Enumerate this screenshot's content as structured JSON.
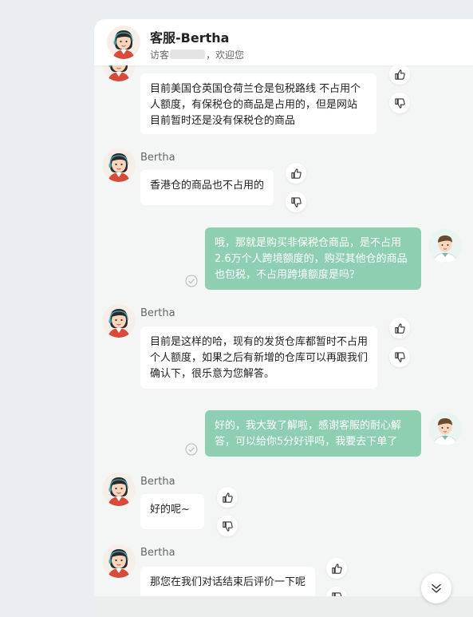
{
  "header": {
    "title": "客服-Bertha",
    "subtitle_prefix": "访客",
    "subtitle_suffix": "，欢迎您"
  },
  "messages": [
    {
      "sender": "Bertha",
      "role": "agent",
      "text": "目前美国仓英国仓荷兰仓是包税路线 不占用个人额度，有保税仓的商品是占用的，但是网站目前暂时还是没有保税仓的商品"
    },
    {
      "sender": "Bertha",
      "role": "agent",
      "text": "香港仓的商品也不占用的"
    },
    {
      "sender": "visitor",
      "role": "user",
      "text": "哦，那就是购买非保税仓商品，是不占用2.6万个人跨境额度的，购买其他仓的商品也包税，不占用跨境额度是吗？"
    },
    {
      "sender": "Bertha",
      "role": "agent",
      "text": "目前是这样的哈，现有的发货仓库都暂时不占用个人额度，如果之后有新增的仓库可以再跟我们确认下，很乐意为您解答。"
    },
    {
      "sender": "visitor",
      "role": "user",
      "text": "好的，我大致了解啦，感谢客服的耐心解答，可以给你5分好评吗，我要去下单了"
    },
    {
      "sender": "Bertha",
      "role": "agent",
      "text": "好的呢~"
    },
    {
      "sender": "Bertha",
      "role": "agent",
      "text": "那您在我们对话结束后评价一下呢"
    }
  ],
  "icons": {
    "like": "thumbs-up-icon",
    "dislike": "thumbs-down-icon",
    "sent": "check-circle-icon",
    "scroll": "chevron-double-down-icon"
  },
  "colors": {
    "user_bubble": "#8ecfb2",
    "agent_bubble": "#ffffff",
    "background": "#f4f5f5"
  }
}
